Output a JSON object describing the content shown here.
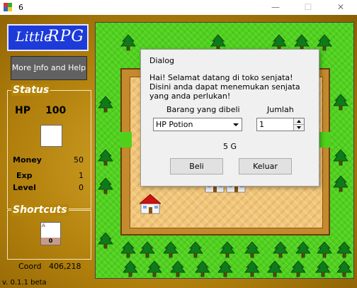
{
  "window": {
    "title": "6",
    "minimize_glyph": "—",
    "maximize_glyph": "☐",
    "close_glyph": "✕"
  },
  "logo": {
    "word1": "Little",
    "word2": "RPG"
  },
  "more_info_button": {
    "label_pre": "More ",
    "label_u": "I",
    "label_post": "nfo and Help"
  },
  "status": {
    "title": "Status",
    "hp_label": "HP",
    "hp_value": "100",
    "money_label": "Money",
    "money_value": "50",
    "exp_label": "Exp",
    "exp_value": "1",
    "level_label": "Level",
    "level_value": "0"
  },
  "shortcuts": {
    "title": "Shortcuts",
    "slot_key": "A",
    "slot_count": "0"
  },
  "coord": {
    "label": "Coord",
    "value": "406,218"
  },
  "version": "v. 0.1.1 beta",
  "dialog": {
    "title": "Dialog",
    "message": "Hai! Selamat datang di toko senjata! Disini anda dapat menemukan senjata yang anda perlukan!",
    "item_label": "Barang yang dibeli",
    "qty_label": "Jumlah",
    "item_value": "HP Potion",
    "qty_value": "1",
    "price": "5 G",
    "buy_button": "Beli",
    "exit_button": "Keluar"
  },
  "colors": {
    "grass": "#4fd11c",
    "yard": "#f1c678",
    "fence": "#c48a2e",
    "roof": "#cc1111",
    "tree": "#0f7a1a"
  }
}
